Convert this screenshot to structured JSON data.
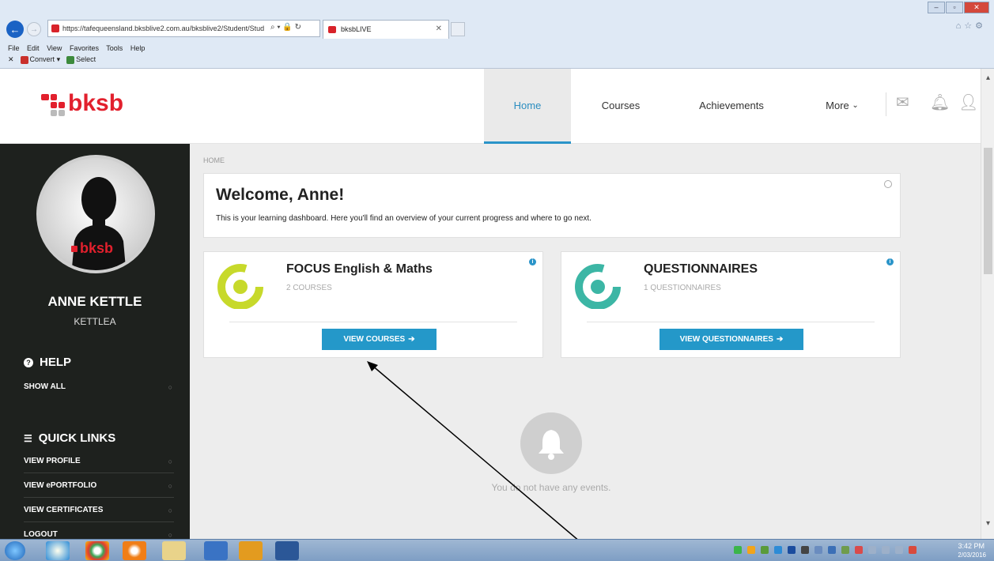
{
  "browser": {
    "url": "https://tafequeensland.bksblive2.com.au/bksblive2/Student/Stud",
    "tab_title": "bksbLIVE",
    "menu": [
      "File",
      "Edit",
      "View",
      "Favorites",
      "Tools",
      "Help"
    ],
    "toolbar": {
      "convert": "Convert",
      "select": "Select"
    }
  },
  "header": {
    "logo": "bksb",
    "nav": {
      "home": "Home",
      "courses": "Courses",
      "achievements": "Achievements",
      "more": "More"
    }
  },
  "sidebar": {
    "avatar_logo": "bksb",
    "name": "ANNE KETTLE",
    "username": "KETTLEA",
    "help_heading": "HELP",
    "show_all": "SHOW ALL",
    "quick_links_heading": "QUICK LINKS",
    "links": [
      {
        "label": "VIEW PROFILE"
      },
      {
        "label": "VIEW ePORTFOLIO"
      },
      {
        "label": "VIEW CERTIFICATES"
      },
      {
        "label": "LOGOUT"
      }
    ]
  },
  "main": {
    "breadcrumb": "HOME",
    "welcome_title": "Welcome, Anne!",
    "welcome_text": "This is your learning dashboard. Here you'll find an overview of your current progress and where to go next.",
    "cards": [
      {
        "title": "FOCUS English & Maths",
        "subtitle": "2 COURSES",
        "button": "VIEW COURSES",
        "color": "#c7d92b"
      },
      {
        "title": "QUESTIONNAIRES",
        "subtitle": "1 QUESTIONNAIRES",
        "button": "VIEW QUESTIONNAIRES",
        "color": "#3cb6a5"
      }
    ],
    "no_events": "You do not have any events."
  },
  "taskbar": {
    "time": "3:42 PM",
    "date": "2/03/2016"
  },
  "colors": {
    "brand_red": "#e2202d",
    "accent_blue": "#2498c9",
    "sidebar_bg": "#1e211e"
  }
}
